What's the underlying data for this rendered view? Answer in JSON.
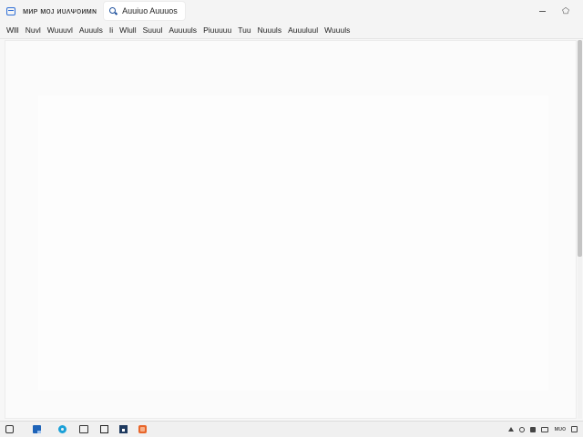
{
  "window": {
    "title": "ᴍᴎᴘ ᴍᴏᴊ ᴎᴜᴧᴪᴏᴎᴍɴ",
    "search_tab_label": "Auuiuo Auuuos",
    "controls": {
      "minimize_icon": "minimize-icon",
      "maximize_icon": "maximize-icon",
      "maximize_glyph": "⬠"
    }
  },
  "menubar": {
    "items": [
      "Wlll",
      "Nuvl",
      "Wuuuvl",
      "Auuuls",
      "Ii",
      "Wlull",
      "Suuul",
      "Auuuuls",
      "Piuuuuu",
      "Tuu",
      "Nuuuls",
      "Auuuluul",
      "Wuuuls"
    ]
  },
  "content": {
    "background": "#fbfbfb"
  },
  "taskbar": {
    "icons": [
      "start-icon",
      "file-explorer-icon",
      "edge-browser-icon",
      "screen-icon",
      "window-icon",
      "store-icon",
      "office-icon"
    ],
    "tray": {
      "time_text": "ᴍᴜᴏ",
      "icons": [
        "tray-up-icon",
        "network-icon",
        "volume-icon",
        "battery-icon",
        "notification-icon"
      ]
    }
  },
  "colors": {
    "accent_blue": "#2f6fd6",
    "search_icon": "#1c4f9c",
    "edge_blue": "#1aa0d8",
    "office_orange": "#e8652a",
    "store_navy": "#1f3a5f"
  }
}
